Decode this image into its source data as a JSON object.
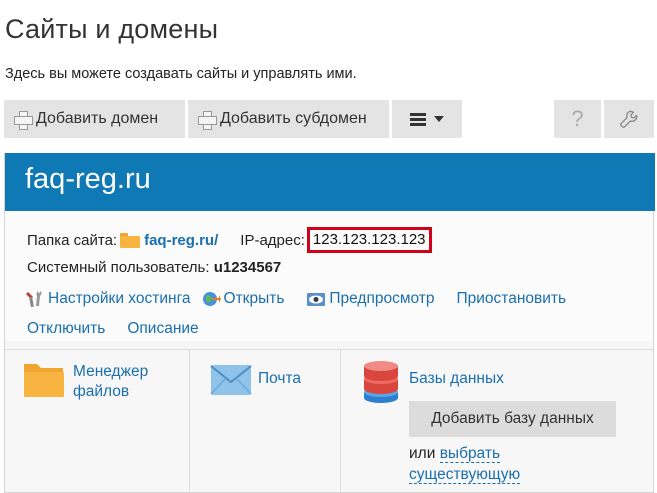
{
  "page": {
    "title": "Сайты и домены",
    "subtitle": "Здесь вы можете создавать сайты и управлять ими."
  },
  "toolbar": {
    "add_domain_label": "Добавить домен",
    "add_subdomain_label": "Добавить субдомен",
    "help_label": "?"
  },
  "domain": {
    "name": "faq-reg.ru",
    "folder_label": "Папка сайта:",
    "folder_value": "faq-reg.ru/",
    "ip_label": "IP-адрес:",
    "ip_value": "123.123.123.123",
    "user_label": "Системный пользователь:",
    "user_value": "u1234567",
    "actions": {
      "hosting_settings": "Настройки хостинга",
      "open": "Открыть",
      "preview": "Предпросмотр",
      "suspend": "Приостановить",
      "disable": "Отключить",
      "description": "Описание"
    }
  },
  "tiles": {
    "file_manager_line1": "Менеджер",
    "file_manager_line2": "файлов",
    "mail": "Почта",
    "databases": "Базы данных",
    "add_db_button": "Добавить базу данных",
    "or_text": "или",
    "choose_line1": "выбрать",
    "choose_line2": "существующую"
  },
  "colors": {
    "header_blue": "#0e79b4",
    "link_blue": "#1a6fae",
    "highlight_red": "#d0021b",
    "button_gray": "#e4e4e4"
  }
}
